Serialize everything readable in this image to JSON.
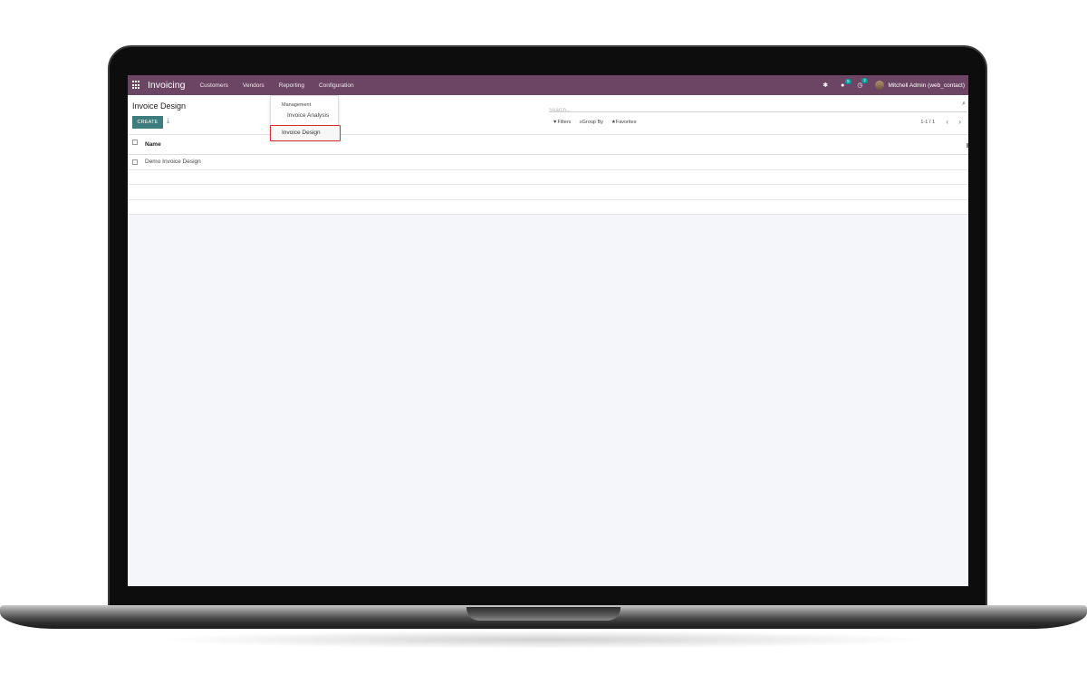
{
  "navbar": {
    "brand": "Invoicing",
    "menu": [
      "Customers",
      "Vendors",
      "Reporting",
      "Configuration"
    ],
    "chat_badge": "5",
    "activity_badge": "2",
    "user_name": "Mitchell Admin (web_contact)"
  },
  "control_panel": {
    "title": "Invoice Design",
    "create_label": "CREATE",
    "search_placeholder": "Search...",
    "filters_label": "Filters",
    "group_by_label": "Group By",
    "favorites_label": "Favorites",
    "pager": "1-1 / 1"
  },
  "list": {
    "column_name": "Name",
    "rows": [
      "Demo Invoice Design"
    ]
  },
  "reporting_dropdown": {
    "section": "Management",
    "items": [
      "Invoice Analysis",
      "Invoice Design"
    ],
    "highlighted": "Invoice Design"
  },
  "colors": {
    "navbar": "#6b4563",
    "primary_button": "#3e7d7e",
    "highlight_border": "#d72a2a",
    "badge": "#00a09d"
  }
}
